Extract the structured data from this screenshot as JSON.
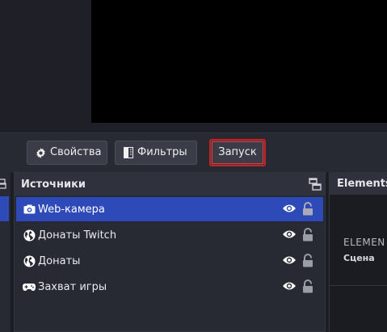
{
  "toolbar": {
    "properties_label": "Свойства",
    "filters_label": "Фильтры",
    "start_label": "Запуск"
  },
  "sources_panel": {
    "title": "Источники",
    "items": [
      {
        "label": "Web-камера",
        "type_icon": "camera-icon",
        "selected": true
      },
      {
        "label": "Донаты Twitch",
        "type_icon": "globe-icon",
        "selected": false
      },
      {
        "label": "Донаты",
        "type_icon": "globe-icon",
        "selected": false
      },
      {
        "label": "Захват игры",
        "type_icon": "gamepad-icon",
        "selected": false
      }
    ]
  },
  "elements_panel": {
    "title": "Elements",
    "card_title": "ELEMEN",
    "card_subtitle": "Сцена"
  },
  "colors": {
    "selection": "#2e4ab8",
    "highlight_border": "#cc1f1f",
    "panel_bg": "#272a33",
    "preview_bg": "#000000"
  }
}
